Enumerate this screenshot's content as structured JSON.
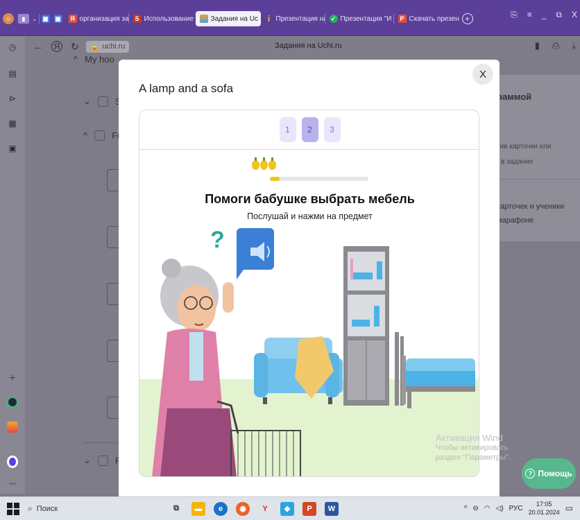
{
  "browser": {
    "tabs": [
      {
        "label": "организация зан",
        "fav_color": "#e74c3c",
        "fav_glyph": "Я"
      },
      {
        "label": "Использование",
        "fav_color": "#c0392b",
        "fav_glyph": "S"
      },
      {
        "label": "Задания на Uc",
        "fav_color": "#f0a030",
        "fav_glyph": "",
        "active": true
      },
      {
        "label": "Презентация на",
        "fav_color": "#f1c40f",
        "fav_glyph": "i"
      },
      {
        "label": "Презентация \"И",
        "fav_color": "#27ae60",
        "fav_glyph": "✓"
      },
      {
        "label": "Скачать презент",
        "fav_color": "#e74c3c",
        "fav_glyph": "P"
      }
    ],
    "url": "uchi.ru",
    "page_title": "Задания на Uchi.ru",
    "close_tab_glyph": "X"
  },
  "background_page": {
    "section_title": "My hoo",
    "rows": [
      {
        "label": "Sh",
        "expanded": false
      },
      {
        "label": "Fu",
        "expanded": true
      },
      {
        "label": "Pr",
        "expanded": false
      }
    ],
    "right_card": {
      "title": "раммой",
      "text1": "тив карточки или",
      "text2": "в задание",
      "text3": "карточек и ученики",
      "text4": "марафоне"
    }
  },
  "modal": {
    "title": "A lamp and a sofa",
    "close_label": "X",
    "pages": [
      "1",
      "2",
      "3"
    ],
    "active_page": 2,
    "task_heading": "Помоги бабушке выбрать мебель",
    "task_subtitle": "Послушай и нажми на предмет",
    "progress": 0.1,
    "lemons_count": 3
  },
  "watermark": {
    "line1": "Активация Wind",
    "line2": "Чтобы активировать",
    "line3": "раздел \"Параметры\"."
  },
  "help_button": {
    "label": "Помощь"
  },
  "taskbar": {
    "search_placeholder": "Поиск",
    "lang": "РУС",
    "time": "17:05",
    "date": "20.01.2024"
  },
  "colors": {
    "tabbar": "#5c3f98",
    "pager_active": "#b9b2ef",
    "pager_inactive": "#e8e6fb",
    "help_green": "#57b88e",
    "grass": "#e3f3cf"
  }
}
